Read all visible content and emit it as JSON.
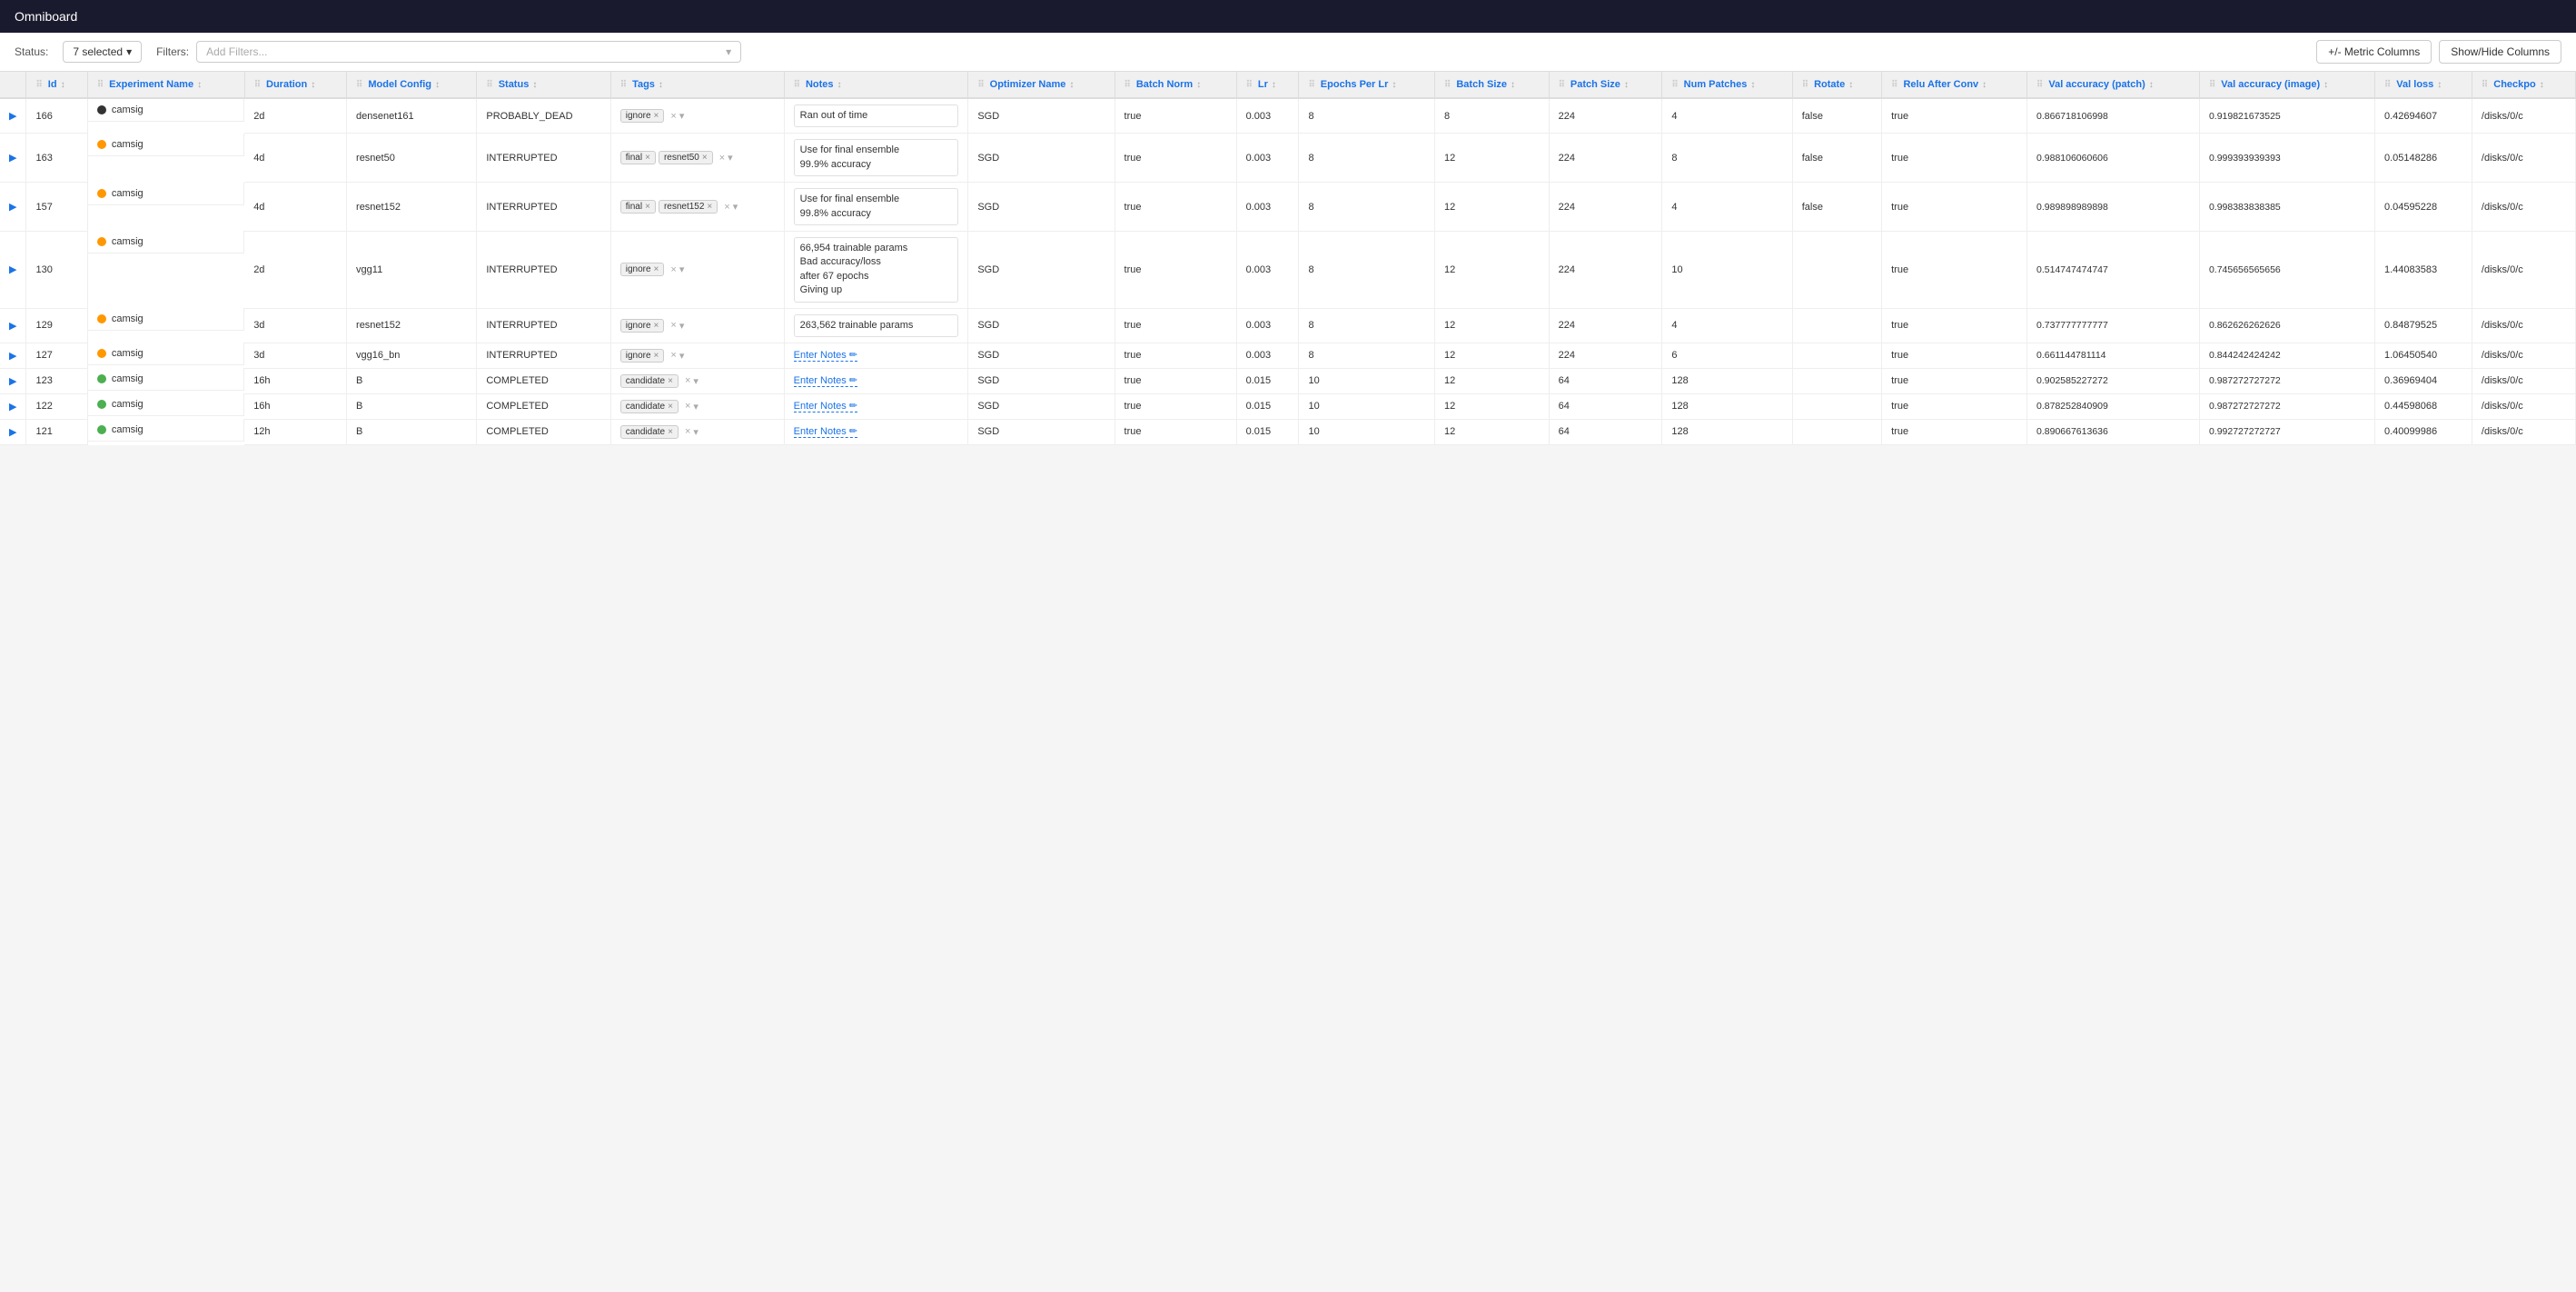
{
  "app": {
    "title": "Omniboard"
  },
  "toolbar": {
    "status_label": "Status:",
    "selected_text": "7 selected",
    "filters_label": "Filters:",
    "filters_placeholder": "Add Filters...",
    "metric_columns_btn": "+/- Metric Columns",
    "show_hide_btn": "Show/Hide Columns"
  },
  "columns": [
    {
      "id": "id",
      "label": "Id"
    },
    {
      "id": "experiment_name",
      "label": "Experiment Name"
    },
    {
      "id": "duration",
      "label": "Duration"
    },
    {
      "id": "model_config",
      "label": "Model Config"
    },
    {
      "id": "status",
      "label": "Status"
    },
    {
      "id": "tags",
      "label": "Tags"
    },
    {
      "id": "notes",
      "label": "Notes"
    },
    {
      "id": "optimizer_name",
      "label": "Optimizer Name"
    },
    {
      "id": "batch_norm",
      "label": "Batch Norm"
    },
    {
      "id": "lr",
      "label": "Lr"
    },
    {
      "id": "epochs_per_lr",
      "label": "Epochs Per Lr"
    },
    {
      "id": "batch_size",
      "label": "Batch Size"
    },
    {
      "id": "patch_size",
      "label": "Patch Size"
    },
    {
      "id": "num_patches",
      "label": "Num Patches"
    },
    {
      "id": "rotate",
      "label": "Rotate"
    },
    {
      "id": "relu_after_conv",
      "label": "Relu After Conv"
    },
    {
      "id": "val_accuracy_patch",
      "label": "Val accuracy (patch)"
    },
    {
      "id": "val_accuracy_image",
      "label": "Val accuracy (image)"
    },
    {
      "id": "val_loss",
      "label": "Val loss"
    },
    {
      "id": "checkpoint",
      "label": "Checkpo"
    }
  ],
  "rows": [
    {
      "id": "166",
      "dot_color": "black",
      "experiment_name": "camsig",
      "duration": "2d",
      "model_config": "densenet161",
      "status": "PROBABLY_DEAD",
      "tags": [
        {
          "label": "ignore"
        }
      ],
      "notes": "Ran out of time",
      "notes_type": "text",
      "optimizer_name": "SGD",
      "batch_norm": "true",
      "lr": "0.003",
      "epochs_per_lr": "8",
      "batch_size": "8",
      "patch_size": "224",
      "num_patches": "4",
      "rotate": "false",
      "relu_after_conv": "true",
      "val_accuracy_patch": "0.866718106998",
      "val_accuracy_image": "0.919821673525",
      "val_loss": "0.42694607",
      "checkpoint": "/disks/0/c"
    },
    {
      "id": "163",
      "dot_color": "orange",
      "experiment_name": "camsig",
      "duration": "4d",
      "model_config": "resnet50",
      "status": "INTERRUPTED",
      "tags": [
        {
          "label": "final"
        },
        {
          "label": "resnet50"
        }
      ],
      "notes": "Use for final ensemble\n99.9% accuracy",
      "notes_type": "text",
      "optimizer_name": "SGD",
      "batch_norm": "true",
      "lr": "0.003",
      "epochs_per_lr": "8",
      "batch_size": "12",
      "patch_size": "224",
      "num_patches": "8",
      "rotate": "false",
      "relu_after_conv": "true",
      "val_accuracy_patch": "0.988106060606",
      "val_accuracy_image": "0.999393939393",
      "val_loss": "0.05148286",
      "checkpoint": "/disks/0/c"
    },
    {
      "id": "157",
      "dot_color": "orange",
      "experiment_name": "camsig",
      "duration": "4d",
      "model_config": "resnet152",
      "status": "INTERRUPTED",
      "tags": [
        {
          "label": "final"
        },
        {
          "label": "resnet152"
        }
      ],
      "notes": "Use for final ensemble\n99.8% accuracy",
      "notes_type": "text",
      "optimizer_name": "SGD",
      "batch_norm": "true",
      "lr": "0.003",
      "epochs_per_lr": "8",
      "batch_size": "12",
      "patch_size": "224",
      "num_patches": "4",
      "rotate": "false",
      "relu_after_conv": "true",
      "val_accuracy_patch": "0.989898989898",
      "val_accuracy_image": "0.998383838385",
      "val_loss": "0.04595228",
      "checkpoint": "/disks/0/c"
    },
    {
      "id": "130",
      "dot_color": "orange",
      "experiment_name": "camsig",
      "duration": "2d",
      "model_config": "vgg11",
      "status": "INTERRUPTED",
      "tags": [
        {
          "label": "ignore"
        }
      ],
      "notes": "66,954 trainable params\nBad accuracy/loss\nafter 67 epochs\nGiving up",
      "notes_type": "text",
      "optimizer_name": "SGD",
      "batch_norm": "true",
      "lr": "0.003",
      "epochs_per_lr": "8",
      "batch_size": "12",
      "patch_size": "224",
      "num_patches": "10",
      "rotate": "",
      "relu_after_conv": "true",
      "val_accuracy_patch": "0.514747474747",
      "val_accuracy_image": "0.745656565656",
      "val_loss": "1.44083583",
      "checkpoint": "/disks/0/c"
    },
    {
      "id": "129",
      "dot_color": "orange",
      "experiment_name": "camsig",
      "duration": "3d",
      "model_config": "resnet152",
      "status": "INTERRUPTED",
      "tags": [
        {
          "label": "ignore"
        }
      ],
      "notes": "263,562 trainable params",
      "notes_type": "text",
      "optimizer_name": "SGD",
      "batch_norm": "true",
      "lr": "0.003",
      "epochs_per_lr": "8",
      "batch_size": "12",
      "patch_size": "224",
      "num_patches": "4",
      "rotate": "",
      "relu_after_conv": "true",
      "val_accuracy_patch": "0.737777777777",
      "val_accuracy_image": "0.862626262626",
      "val_loss": "0.84879525",
      "checkpoint": "/disks/0/c"
    },
    {
      "id": "127",
      "dot_color": "orange",
      "experiment_name": "camsig",
      "duration": "3d",
      "model_config": "vgg16_bn",
      "status": "INTERRUPTED",
      "tags": [
        {
          "label": "ignore"
        }
      ],
      "notes": "",
      "notes_type": "enter",
      "optimizer_name": "SGD",
      "batch_norm": "true",
      "lr": "0.003",
      "epochs_per_lr": "8",
      "batch_size": "12",
      "patch_size": "224",
      "num_patches": "6",
      "rotate": "",
      "relu_after_conv": "true",
      "val_accuracy_patch": "0.661144781114",
      "val_accuracy_image": "0.844242424242",
      "val_loss": "1.06450540",
      "checkpoint": "/disks/0/c"
    },
    {
      "id": "123",
      "dot_color": "green",
      "experiment_name": "camsig",
      "duration": "16h",
      "model_config": "B",
      "status": "COMPLETED",
      "tags": [
        {
          "label": "candidate"
        }
      ],
      "notes": "",
      "notes_type": "enter",
      "optimizer_name": "SGD",
      "batch_norm": "true",
      "lr": "0.015",
      "epochs_per_lr": "10",
      "batch_size": "12",
      "patch_size": "64",
      "num_patches": "128",
      "rotate": "",
      "relu_after_conv": "true",
      "val_accuracy_patch": "0.902585227272",
      "val_accuracy_image": "0.987272727272",
      "val_loss": "0.36969404",
      "checkpoint": "/disks/0/c"
    },
    {
      "id": "122",
      "dot_color": "green",
      "experiment_name": "camsig",
      "duration": "16h",
      "model_config": "B",
      "status": "COMPLETED",
      "tags": [
        {
          "label": "candidate"
        }
      ],
      "notes": "",
      "notes_type": "enter",
      "optimizer_name": "SGD",
      "batch_norm": "true",
      "lr": "0.015",
      "epochs_per_lr": "10",
      "batch_size": "12",
      "patch_size": "64",
      "num_patches": "128",
      "rotate": "",
      "relu_after_conv": "true",
      "val_accuracy_patch": "0.878252840909",
      "val_accuracy_image": "0.987272727272",
      "val_loss": "0.44598068",
      "checkpoint": "/disks/0/c"
    },
    {
      "id": "121",
      "dot_color": "green",
      "experiment_name": "camsig",
      "duration": "12h",
      "model_config": "B",
      "status": "COMPLETED",
      "tags": [
        {
          "label": "candidate"
        }
      ],
      "notes": "",
      "notes_type": "enter",
      "optimizer_name": "SGD",
      "batch_norm": "true",
      "lr": "0.015",
      "epochs_per_lr": "10",
      "batch_size": "12",
      "patch_size": "64",
      "num_patches": "128",
      "rotate": "",
      "relu_after_conv": "true",
      "val_accuracy_patch": "0.890667613636",
      "val_accuracy_image": "0.992727272727",
      "val_loss": "0.40099986",
      "checkpoint": "/disks/0/c"
    }
  ],
  "enter_notes_label": "Enter Notes",
  "chevron_down": "▾",
  "sort_icon": "↕"
}
